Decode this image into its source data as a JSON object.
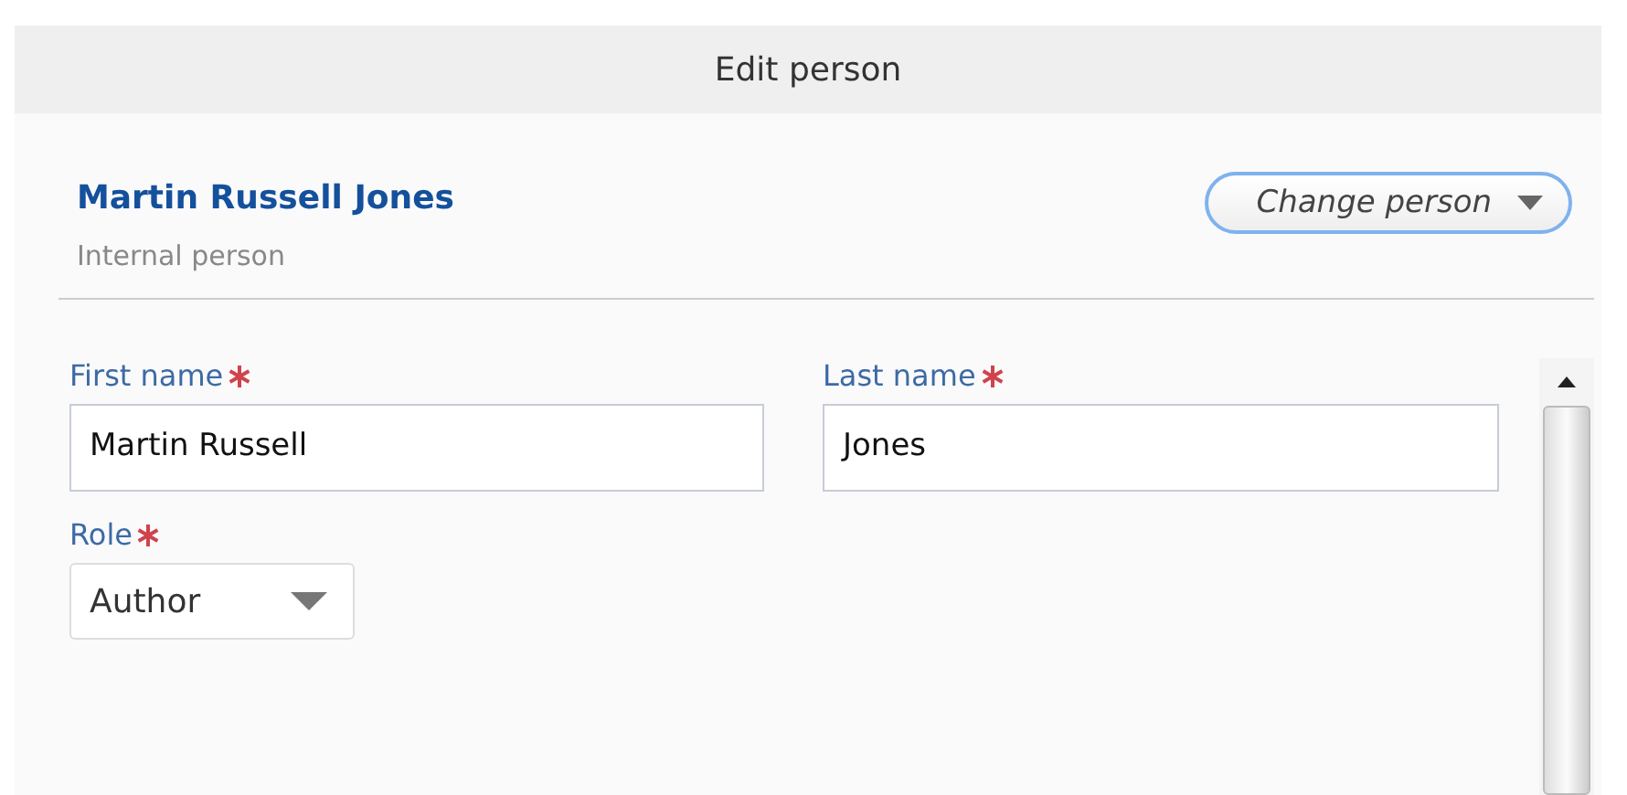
{
  "window": {
    "title": "Edit person"
  },
  "person": {
    "name": "Martin Russell Jones",
    "type": "Internal person"
  },
  "change_button": {
    "label": "Change person"
  },
  "fields": [
    {
      "kind": "text",
      "label": "First name",
      "required": true,
      "value": "Martin Russell"
    },
    {
      "kind": "text",
      "label": "Last name",
      "required": true,
      "value": "Jones"
    },
    {
      "kind": "select",
      "label": "Role",
      "required": true,
      "value": "Author"
    }
  ]
}
